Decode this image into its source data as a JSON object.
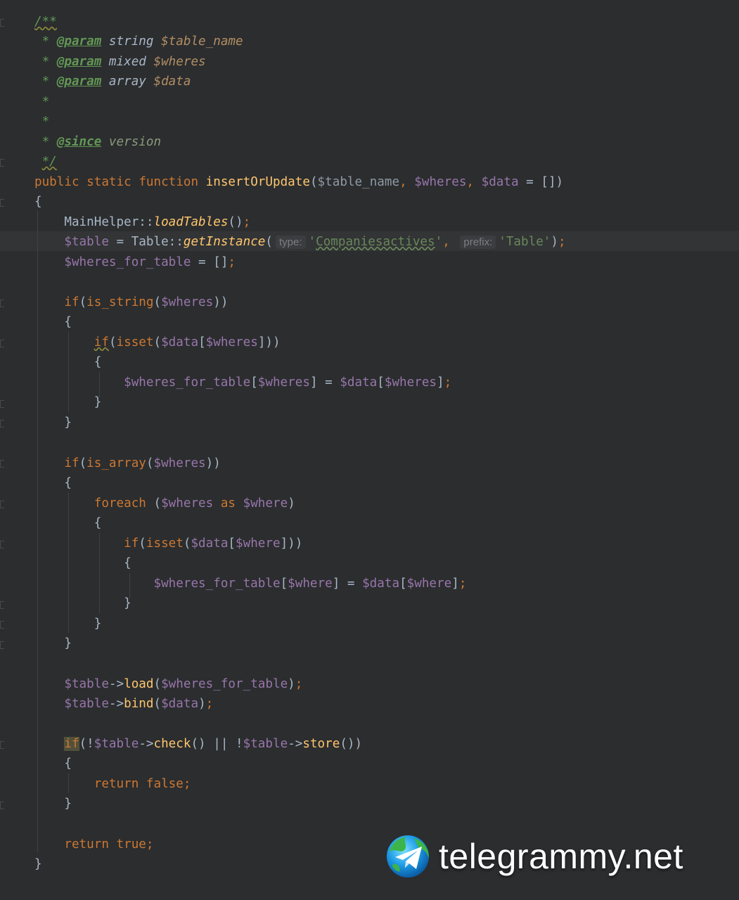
{
  "doc": {
    "open": "/**",
    "lines": [
      {
        "star": " * ",
        "tag": "@param",
        "type": " string ",
        "var": "$table_name"
      },
      {
        "star": " * ",
        "tag": "@param",
        "type": " mixed ",
        "var": "$wheres"
      },
      {
        "star": " * ",
        "tag": "@param",
        "type": " array ",
        "var": "$data"
      }
    ],
    "empty": " *",
    "since_tag": "@since",
    "since_text": " version",
    "close": "*/"
  },
  "code": {
    "signature": {
      "kw1": "public",
      "kw2": "static",
      "kw3": "function",
      "name": "insertOrUpdate",
      "p1": "$table_name",
      "p2": "$wheres",
      "p3": "$data"
    },
    "main_helper": "MainHelper::",
    "load_tables": "loadTables",
    "table_var": "$table",
    "table_class": "Table::",
    "get_instance": "getInstance",
    "hint_type": "type:",
    "arg_type": "Companiesactives",
    "hint_prefix": "prefix:",
    "arg_prefix": "'Table'",
    "wheres_for_table": "$wheres_for_table",
    "is_string": "is_string",
    "is_array": "is_array",
    "isset": "isset",
    "foreach": "foreach",
    "as": "as",
    "where_var": "$where",
    "data_var": "$data",
    "wheres_var": "$wheres",
    "load": "load",
    "bind": "bind",
    "check": "check",
    "store": "store",
    "kw_if": "if",
    "kw_return": "return",
    "kw_false": "false",
    "kw_true": "true"
  },
  "watermark": {
    "text": "telegrammy.net",
    "icon": "telegram-globe-icon"
  }
}
